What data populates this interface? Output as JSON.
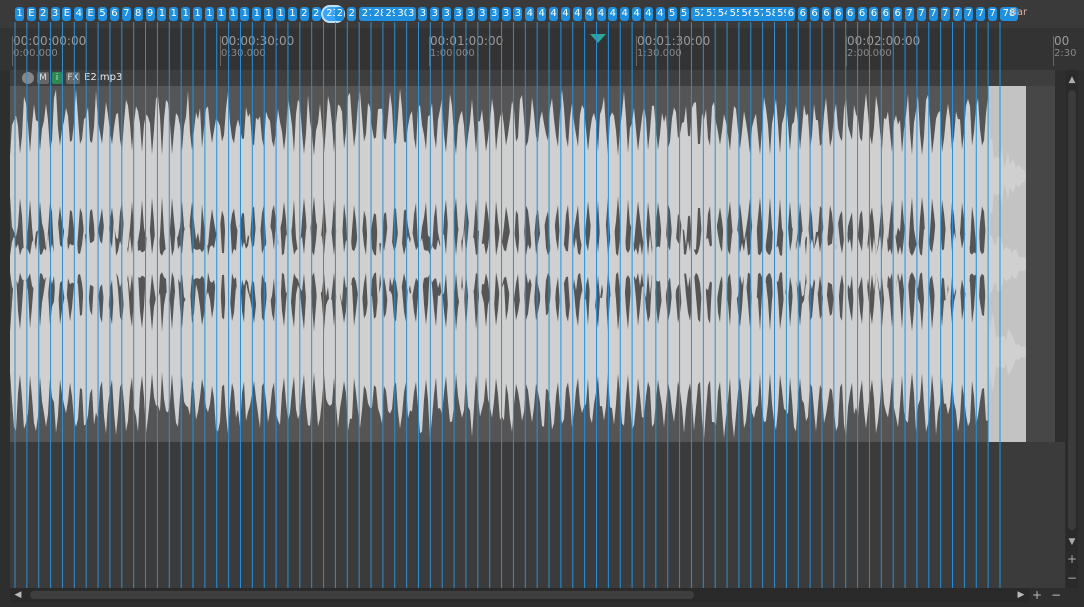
{
  "markers": {
    "labels": [
      "1",
      "E",
      "2",
      "3",
      "E",
      "4",
      "E",
      "5",
      "6",
      "7",
      "8",
      "9",
      "1",
      "1",
      "1",
      "1",
      "1",
      "1",
      "1",
      "1",
      "1",
      "1",
      "1",
      "1",
      "2",
      "2",
      "23",
      "2",
      "2",
      "27",
      "28",
      "29",
      "30",
      "3",
      "3",
      "3",
      "3",
      "3",
      "3",
      "3",
      "3",
      "3",
      "3",
      "4",
      "4",
      "4",
      "4",
      "4",
      "4",
      "4",
      "4",
      "4",
      "4",
      "4",
      "4",
      "5",
      "5",
      "52",
      "53",
      "54",
      "55",
      "56",
      "57",
      "58",
      "59",
      "6",
      "6",
      "6",
      "6",
      "6",
      "6",
      "6",
      "6",
      "6",
      "6",
      "7",
      "7",
      "7",
      "7",
      "7",
      "7",
      "7",
      "7",
      "78"
    ],
    "current": "23",
    "bar_label": "Bar"
  },
  "ruler": [
    {
      "top": "00:00:00:00",
      "bottom": "0:00.000"
    },
    {
      "top": "00:00:30:00",
      "bottom": "0:30.000"
    },
    {
      "top": "00:01:00:00",
      "bottom": "1:00.000"
    },
    {
      "top": "00:01:30:00",
      "bottom": "1:30.000"
    },
    {
      "top": "00:02:00:00",
      "bottom": "2:00.000"
    },
    {
      "top": "00",
      "bottom": "2:30"
    }
  ],
  "track": {
    "buttons": [
      "",
      "M",
      "i",
      "FX"
    ],
    "clip_name": "E2.mp3"
  },
  "scroll": {
    "plus": "+",
    "minus": "−",
    "left": "◀",
    "right": "▶",
    "up": "▲",
    "down": "▼"
  },
  "colors": {
    "marker": "#1f8fe0",
    "grid_line": "#2a8fd6",
    "waveform": "#d0d0d0",
    "playhead": "#2aa596"
  }
}
